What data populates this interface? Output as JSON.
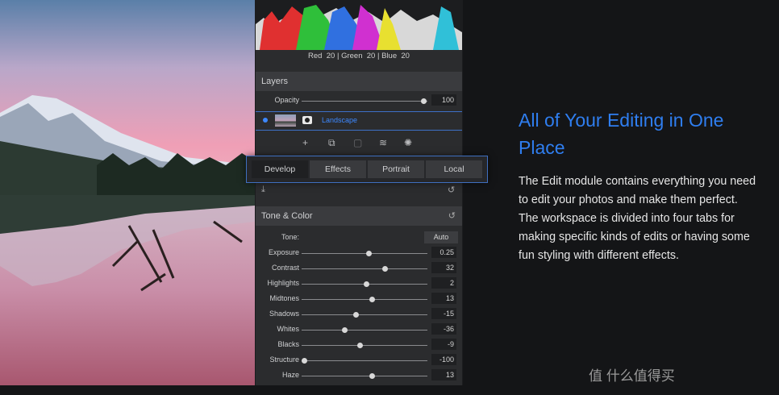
{
  "histogram": {
    "labels": [
      "Red",
      "Green",
      "Blue"
    ],
    "values": [
      "20",
      "20",
      "20"
    ],
    "separator": "|"
  },
  "layers": {
    "title": "Layers",
    "opacity_label": "Opacity",
    "opacity_value": "100",
    "opacity_level": 0.97,
    "layer_name": "Landscape"
  },
  "tabs": {
    "items": [
      "Develop",
      "Effects",
      "Portrait",
      "Local"
    ],
    "active": "Develop"
  },
  "tone_color": {
    "title": "Tone & Color",
    "tone_label": "Tone:",
    "auto_label": "Auto",
    "sliders": [
      {
        "label": "Exposure",
        "value": "0.25",
        "pos": 0.53
      },
      {
        "label": "Contrast",
        "value": "32",
        "pos": 0.66
      },
      {
        "label": "Highlights",
        "value": "2",
        "pos": 0.51
      },
      {
        "label": "Midtones",
        "value": "13",
        "pos": 0.56
      },
      {
        "label": "Shadows",
        "value": "-15",
        "pos": 0.43
      },
      {
        "label": "Whites",
        "value": "-36",
        "pos": 0.34
      },
      {
        "label": "Blacks",
        "value": "-9",
        "pos": 0.46
      },
      {
        "label": "Structure",
        "value": "-100",
        "pos": 0.02
      },
      {
        "label": "Haze",
        "value": "13",
        "pos": 0.56
      }
    ]
  },
  "article": {
    "heading": "All of Your Editing in One Place",
    "body": "The Edit module contains everything you need to edit your photos and make them perfect. The workspace is divided into four tabs for making specific kinds of edits or having some fun styling with different effects."
  },
  "watermark": "值 什么值得买",
  "colors": {
    "accent": "#2f7ef0",
    "panel": "#2b2c2e",
    "background": "#141517"
  }
}
